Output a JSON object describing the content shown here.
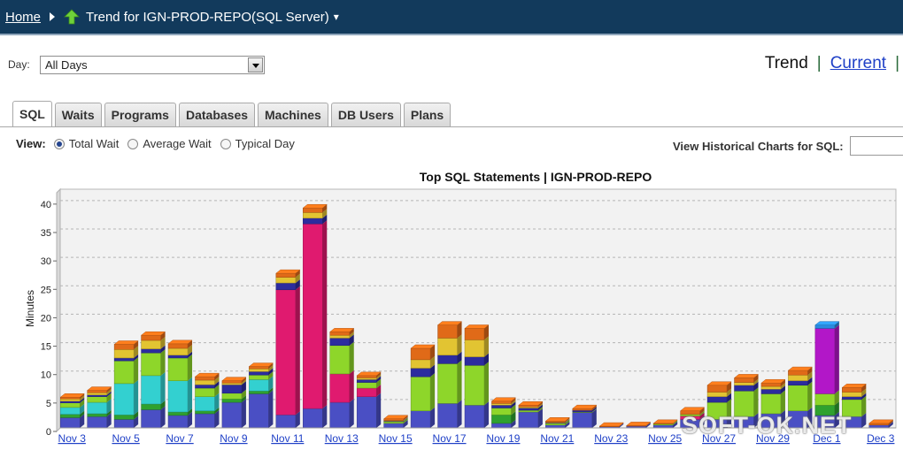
{
  "header": {
    "home_label": "Home",
    "title": "Trend for IGN-PROD-REPO(SQL Server)",
    "caret": "▾"
  },
  "day": {
    "label": "Day:",
    "selected": "All Days"
  },
  "view_links": {
    "trend": "Trend",
    "separator": "|",
    "current": "Current"
  },
  "tabs": [
    "SQL",
    "Waits",
    "Programs",
    "Databases",
    "Machines",
    "DB Users",
    "Plans"
  ],
  "active_tab": "SQL",
  "view_options": {
    "label": "View:",
    "options": [
      "Total Wait",
      "Average Wait",
      "Typical Day"
    ],
    "selected": "Total Wait"
  },
  "historical": {
    "label": "View Historical Charts for SQL:"
  },
  "watermark": "SOFT-OK.NET",
  "chart_data": {
    "type": "bar",
    "stacked": true,
    "title": "Top SQL Statements  |  IGN-PROD-REPO",
    "ylabel": "Minutes",
    "ylim": [
      0,
      42
    ],
    "yticks": [
      0,
      5,
      10,
      15,
      20,
      25,
      30,
      35,
      40
    ],
    "grid": true,
    "categories": [
      "Nov 3",
      "Nov 4",
      "Nov 5",
      "Nov 6",
      "Nov 7",
      "Nov 8",
      "Nov 9",
      "Nov 10",
      "Nov 11",
      "Nov 12",
      "Nov 13",
      "Nov 14",
      "Nov 15",
      "Nov 16",
      "Nov 17",
      "Nov 18",
      "Nov 19",
      "Nov 20",
      "Nov 21",
      "Nov 22",
      "Nov 23",
      "Nov 24",
      "Nov 25",
      "Nov 26",
      "Nov 27",
      "Nov 28",
      "Nov 29",
      "Nov 30",
      "Dec 1",
      "Dec 2",
      "Dec 3"
    ],
    "x_tick_labels": [
      "Nov 3",
      "Nov 5",
      "Nov 7",
      "Nov 9",
      "Nov 11",
      "Nov 13",
      "Nov 15",
      "Nov 17",
      "Nov 19",
      "Nov 21",
      "Nov 23",
      "Nov 25",
      "Nov 27",
      "Nov 29",
      "Dec 1",
      "Dec 3"
    ],
    "series_colors": [
      "#4a4fc4",
      "#2fa12f",
      "#33d0d0",
      "#e01a6f",
      "#8ed62a",
      "#2c2c9e",
      "#e2c432",
      "#e06a18",
      "#b217c8",
      "#2a8ae0"
    ],
    "bars": [
      [
        1.8,
        0.6,
        1.2,
        0,
        0.8,
        0.3,
        0.4,
        0.3
      ],
      [
        2.0,
        0.5,
        2.0,
        0,
        1.0,
        0.3,
        0.4,
        0.4
      ],
      [
        1.5,
        0.8,
        5.5,
        0,
        4.0,
        0.5,
        1.5,
        0.9
      ],
      [
        3.2,
        1.0,
        5.0,
        0,
        4.0,
        0.7,
        1.5,
        0.9
      ],
      [
        2.2,
        0.6,
        5.5,
        0,
        4.0,
        0.5,
        1.2,
        0.8
      ],
      [
        2.5,
        0.5,
        2.5,
        0,
        1.5,
        0.6,
        0.8,
        0.6
      ],
      [
        4.5,
        0.6,
        0,
        0,
        1.0,
        1.5,
        0.3,
        0.4
      ],
      [
        6.0,
        0.5,
        2.0,
        0,
        0.8,
        0.6,
        0.5,
        0.4
      ],
      [
        2.3,
        0,
        0,
        22.0,
        0,
        1.2,
        1.0,
        0.7
      ],
      [
        3.4,
        0,
        0,
        32.5,
        0,
        1.0,
        1.0,
        0.8
      ],
      [
        4.5,
        0,
        0,
        5.0,
        5.0,
        1.3,
        0.5,
        0.6
      ],
      [
        5.5,
        0,
        0,
        1.5,
        1.0,
        0.5,
        0.3,
        0.4
      ],
      [
        0.8,
        0,
        0,
        0,
        0.3,
        0.1,
        0.1,
        0.3
      ],
      [
        3.0,
        0,
        0,
        0,
        6.0,
        1.5,
        1.5,
        2.0
      ],
      [
        4.3,
        0,
        0,
        0,
        7.0,
        1.5,
        3.0,
        2.3
      ],
      [
        4.0,
        0,
        0,
        0,
        7.0,
        1.5,
        3.0,
        2.0
      ],
      [
        0.8,
        1.5,
        0,
        0,
        1.2,
        0.5,
        0.3,
        0.4
      ],
      [
        2.8,
        0,
        0,
        0,
        0.3,
        0.4,
        0.2,
        0.3
      ],
      [
        0.5,
        0,
        0,
        0,
        0.3,
        0.1,
        0.1,
        0.2
      ],
      [
        2.7,
        0,
        0,
        0,
        0.1,
        0.3,
        0,
        0.3
      ],
      [
        0.2,
        0,
        0,
        0,
        0,
        0,
        0,
        0.1
      ],
      [
        0.3,
        0,
        0,
        0,
        0,
        0,
        0,
        0.1
      ],
      [
        0.5,
        0,
        0,
        0,
        0.2,
        0,
        0,
        0.1
      ],
      [
        1.5,
        0,
        0,
        0.6,
        0.3,
        0,
        0,
        0.6
      ],
      [
        1.5,
        0,
        0,
        0,
        3.0,
        1.0,
        0.8,
        1.2
      ],
      [
        2.0,
        0,
        0,
        0,
        4.5,
        1.0,
        0.5,
        0.8
      ],
      [
        2.5,
        0,
        0,
        0,
        3.5,
        0.8,
        0.5,
        0.6
      ],
      [
        3.0,
        0,
        0,
        0,
        4.5,
        0.8,
        1.0,
        0.8
      ],
      [
        2.2,
        1.8,
        0,
        0,
        2.0,
        0,
        0,
        0,
        11.5,
        0.6
      ],
      [
        2.0,
        0,
        0,
        0,
        3.0,
        0.5,
        0.8,
        0.8
      ],
      [
        0.5,
        0,
        0,
        0,
        0,
        0,
        0,
        0.3
      ]
    ]
  }
}
